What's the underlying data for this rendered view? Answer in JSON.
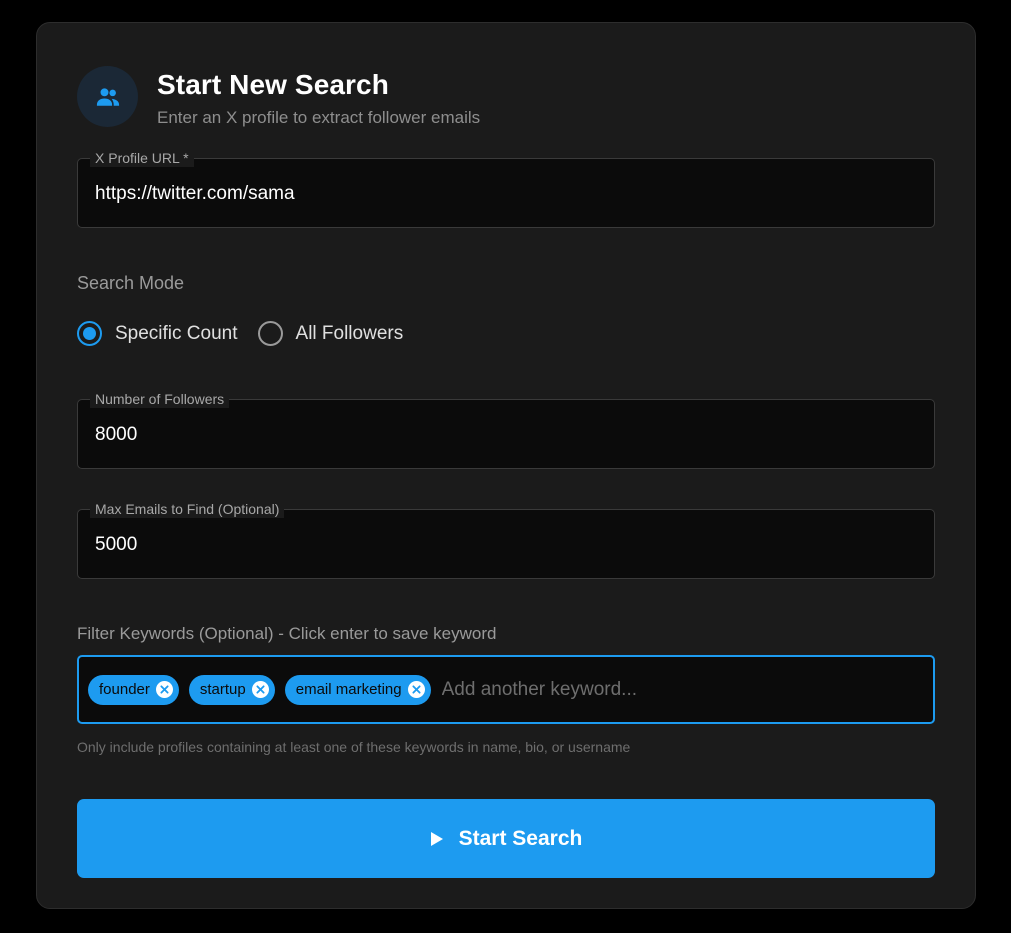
{
  "header": {
    "title": "Start New Search",
    "subtitle": "Enter an X profile to extract follower emails",
    "icon": "people-group-icon"
  },
  "profile_url": {
    "label": "X Profile URL *",
    "value": "https://twitter.com/sama"
  },
  "search_mode": {
    "label": "Search Mode",
    "options": [
      {
        "label": "Specific Count",
        "checked": true
      },
      {
        "label": "All Followers",
        "checked": false
      }
    ]
  },
  "followers": {
    "label": "Number of Followers",
    "value": "8000"
  },
  "max_emails": {
    "label": "Max Emails to Find (Optional)",
    "value": "5000"
  },
  "keywords": {
    "label": "Filter Keywords (Optional) - Click enter to save keyword",
    "chips": [
      "founder",
      "startup",
      "email marketing"
    ],
    "placeholder": "Add another keyword...",
    "helper": "Only include profiles containing at least one of these keywords in name, bio, or username"
  },
  "start_button": {
    "label": "Start Search",
    "icon": "play-icon"
  },
  "colors": {
    "accent": "#1d9bf0",
    "background": "#000000",
    "card": "#1b1b1b"
  }
}
